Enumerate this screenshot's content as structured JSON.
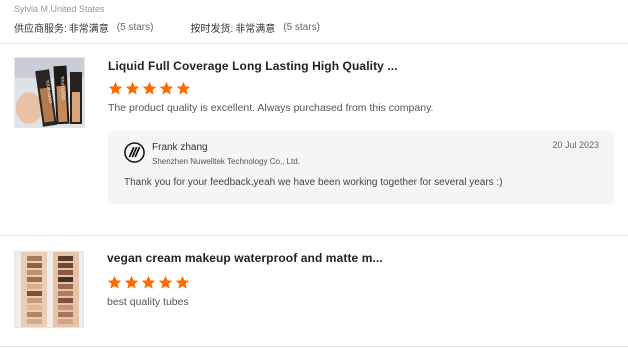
{
  "header": {
    "reviewer": "Sylvia M,United States",
    "ratings": [
      {
        "label": "供应商服务:",
        "value": "非常满意",
        "note": "(5 stars)"
      },
      {
        "label": "按时发货:",
        "value": "非常满意",
        "note": "(5 stars)"
      }
    ]
  },
  "reviews": [
    {
      "thumb_icon": "foundation-bottles-photo",
      "product_title": "Liquid Full Coverage Long Lasting High Quality ...",
      "stars": 5,
      "text": "The product quality is excellent. Always purchased from this company.",
      "reply": {
        "name": "Frank zhang",
        "company": "Shenzhen Nuwelltek Technology Co., Ltd.",
        "date": "20 Jul 2023",
        "text": "Thank you for your feedback,yeah we have been working together for several years :)"
      }
    },
    {
      "thumb_icon": "skin-swatches-photo",
      "product_title": "vegan cream makeup waterproof and matte m...",
      "stars": 5,
      "text": "best quality tubes"
    }
  ],
  "colors": {
    "star": "#ff6a00",
    "divider": "#e6e6e6",
    "reply_bg": "#f5f5f7"
  }
}
